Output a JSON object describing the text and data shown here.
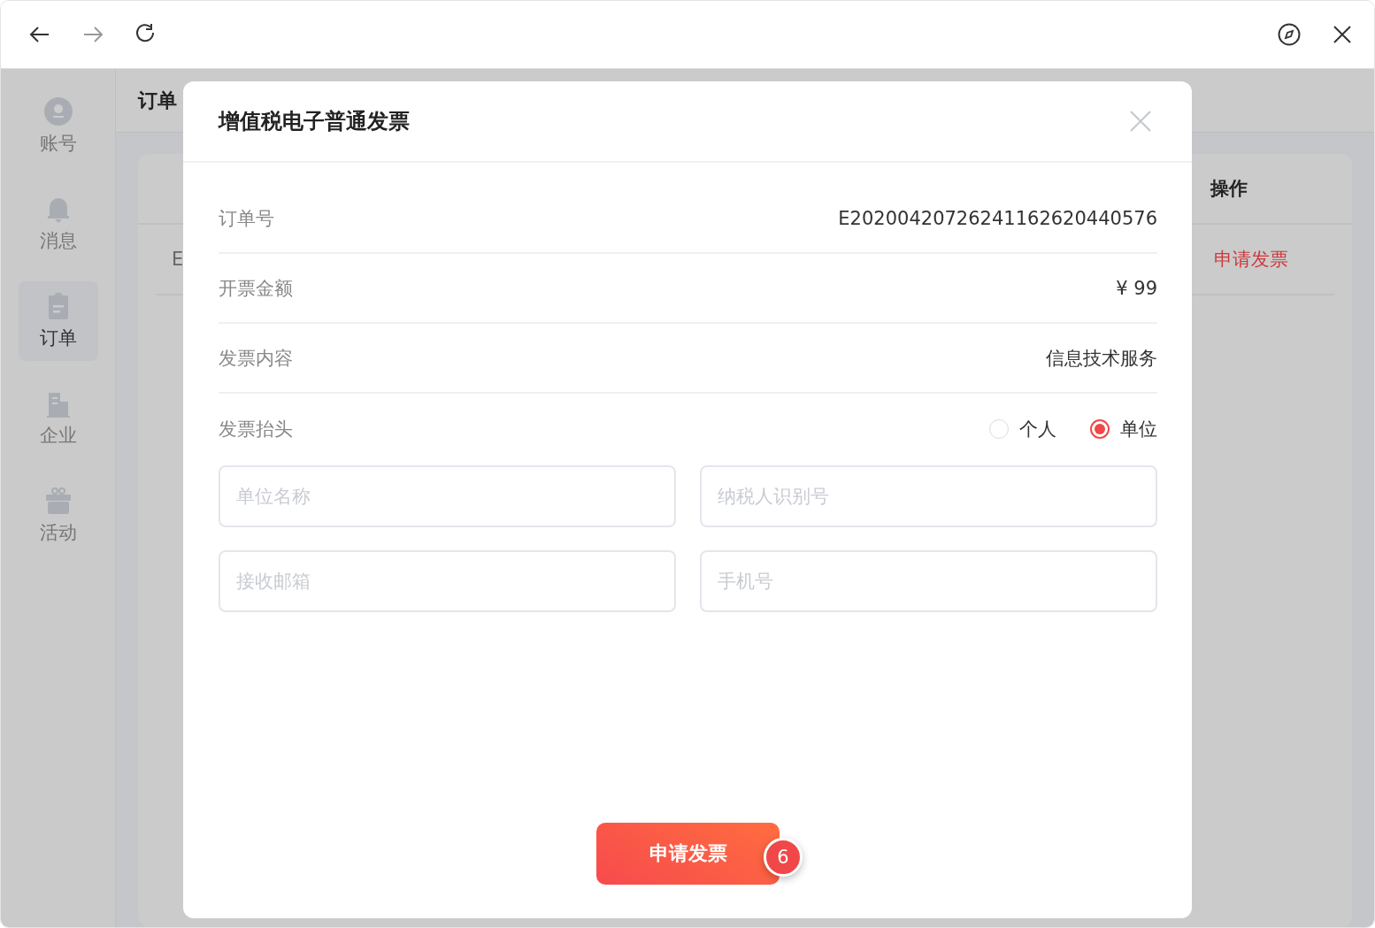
{
  "sidebar": {
    "items": [
      {
        "label": "账号",
        "selected": false
      },
      {
        "label": "消息",
        "selected": false
      },
      {
        "label": "订单",
        "selected": true
      },
      {
        "label": "企业",
        "selected": false
      },
      {
        "label": "活动",
        "selected": false
      }
    ]
  },
  "page": {
    "title": "订单",
    "table": {
      "columns": [
        "操作"
      ],
      "rows": [
        {
          "column_1": "E",
          "action": "申请发票"
        }
      ]
    }
  },
  "dialog": {
    "title": "增值税电子普通发票",
    "details": [
      {
        "label": "订单号",
        "value": "E20200420726241162620440576"
      },
      {
        "label": "开票金额",
        "value": "¥ 99"
      },
      {
        "label": "发票内容",
        "value": "信息技术服务"
      }
    ],
    "header_type": {
      "label": "发票抬头",
      "options": [
        {
          "label": "个人",
          "selected": false
        },
        {
          "label": "单位",
          "selected": true
        }
      ]
    },
    "fields": [
      {
        "placeholder": "单位名称"
      },
      {
        "placeholder": "纳税人识别号"
      },
      {
        "placeholder": "接收邮箱"
      },
      {
        "placeholder": "手机号"
      }
    ],
    "submit": {
      "label": "申请发票",
      "badge": "6"
    }
  }
}
